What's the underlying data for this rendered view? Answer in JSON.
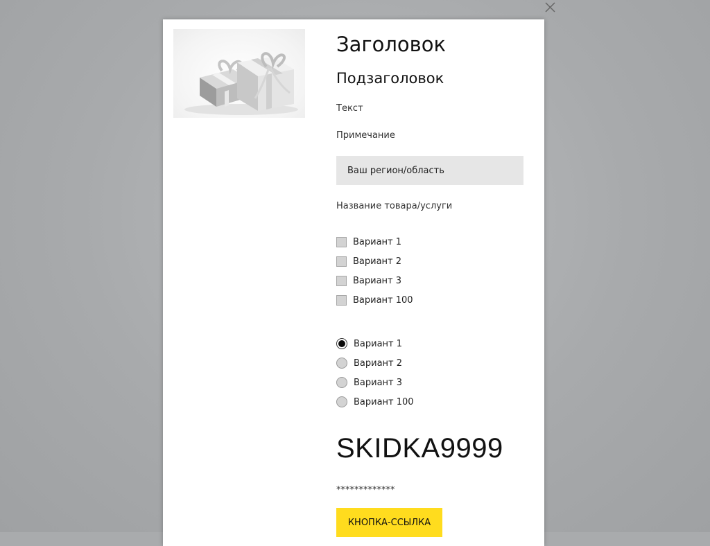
{
  "popup": {
    "close_icon": "close-icon",
    "image_icon": "gift-boxes-image",
    "title": "Заголовок",
    "subtitle": "Подзаголовок",
    "text": "Текст",
    "note": "Примечание",
    "region_field": {
      "value": "Ваш регион/область"
    },
    "product_label": "Название товара/услуги",
    "checkbox_options": [
      {
        "label": "Вариант 1",
        "checked": false
      },
      {
        "label": "Вариант 2",
        "checked": false
      },
      {
        "label": "Вариант 3",
        "checked": false
      },
      {
        "label": "Вариант 100",
        "checked": false
      }
    ],
    "radio_options": [
      {
        "label": "Вариант 1",
        "checked": true
      },
      {
        "label": "Вариант 2",
        "checked": false
      },
      {
        "label": "Вариант 3",
        "checked": false
      },
      {
        "label": "Вариант 100",
        "checked": false
      }
    ],
    "promo_code": "SKIDKA9999",
    "masked_text": "*************",
    "button_label": "КНОПКА-ССЫЛКА"
  },
  "colors": {
    "overlay": "#a9abad",
    "button": "#ffdc1e",
    "field_background": "#e6e6e6"
  }
}
